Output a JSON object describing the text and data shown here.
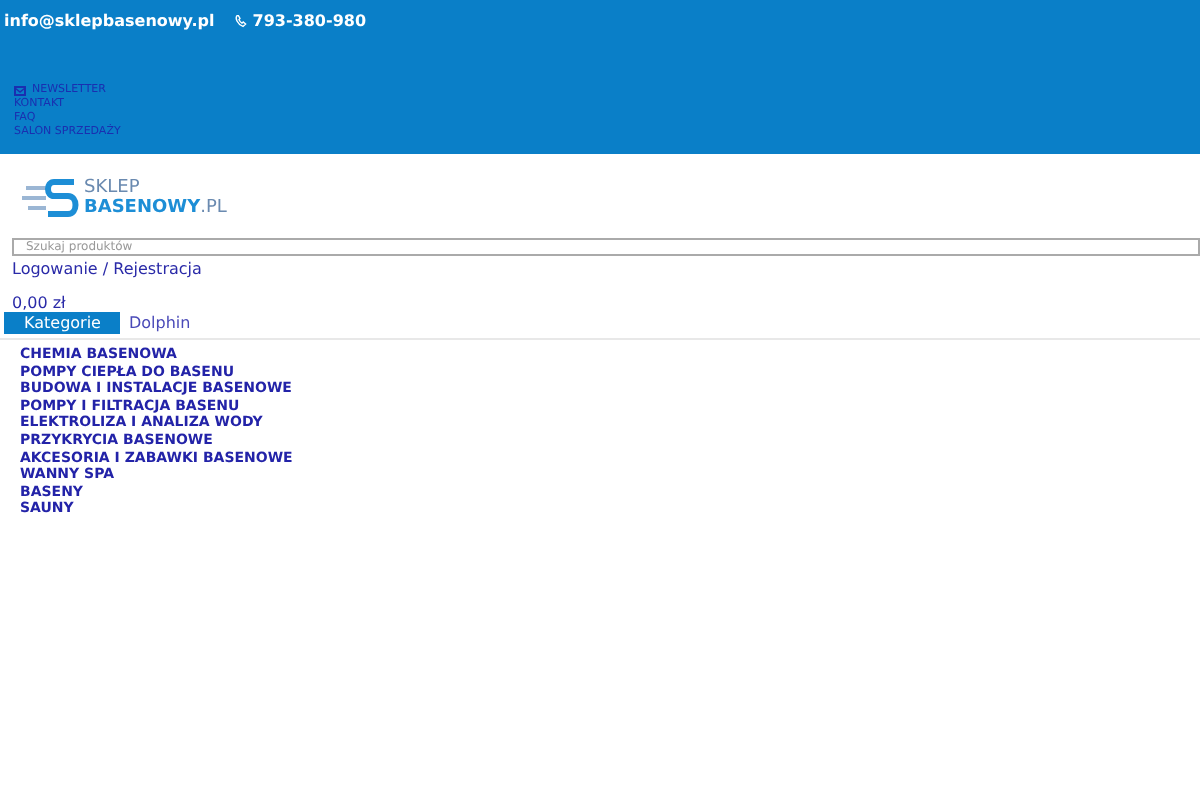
{
  "topbar": {
    "email": "info@sklepbasenowy.pl",
    "phone": "793-380-980",
    "links": [
      "NEWSLETTER",
      "KONTAKT",
      "FAQ",
      "SALON SPRZEDAŻY"
    ]
  },
  "logo": {
    "line_1": "SKLEP",
    "line_2": "BASENOWY",
    "suffix": ".PL"
  },
  "search": {
    "placeholder": "Szukaj produktów"
  },
  "account": {
    "link": "Logowanie / Rejestracja"
  },
  "cart": {
    "total": "0,00 zł"
  },
  "categories": {
    "button": "Kategorie",
    "promo": "Dolphin",
    "items": [
      "CHEMIA BASENOWA",
      "POMPY CIEPŁA DO BASENU",
      "BUDOWA I INSTALACJE BASENOWE",
      "POMPY I FILTRACJA BASENU",
      "ELEKTROLIZA I ANALIZA WODY",
      "PRZYKRYCIA BASENOWE",
      "AKCESORIA I ZABAWKI BASENOWE",
      "WANNY SPA",
      "BASENY",
      "SAUNY"
    ]
  }
}
